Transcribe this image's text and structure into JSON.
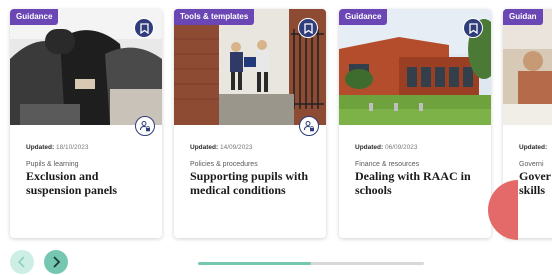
{
  "cards": [
    {
      "tag": "Guidance",
      "updated_label": "Updated:",
      "updated_date": "18/10/2023",
      "category": "Pupils & learning",
      "title": "Exclusion and suspension panels"
    },
    {
      "tag": "Tools & templates",
      "updated_label": "Updated:",
      "updated_date": "14/09/2023",
      "category": "Policies & procedures",
      "title": "Supporting pupils with medical conditions"
    },
    {
      "tag": "Guidance",
      "updated_label": "Updated:",
      "updated_date": "06/09/2023",
      "category": "Finance & resources",
      "title": "Dealing with RAAC in schools"
    },
    {
      "tag": "Guidan",
      "updated_label": "Updated:",
      "updated_date": "",
      "category": "Governi",
      "title": "Gover skills"
    }
  ],
  "carousel": {
    "progress_fraction": 0.5,
    "prev_icon": "chevron-left-icon",
    "next_icon": "chevron-right-icon"
  },
  "colors": {
    "tag": "#6b46b5",
    "bookmark": "#2f3d7a",
    "accent": "#76c7b2",
    "accent_light": "#cdeee5"
  }
}
